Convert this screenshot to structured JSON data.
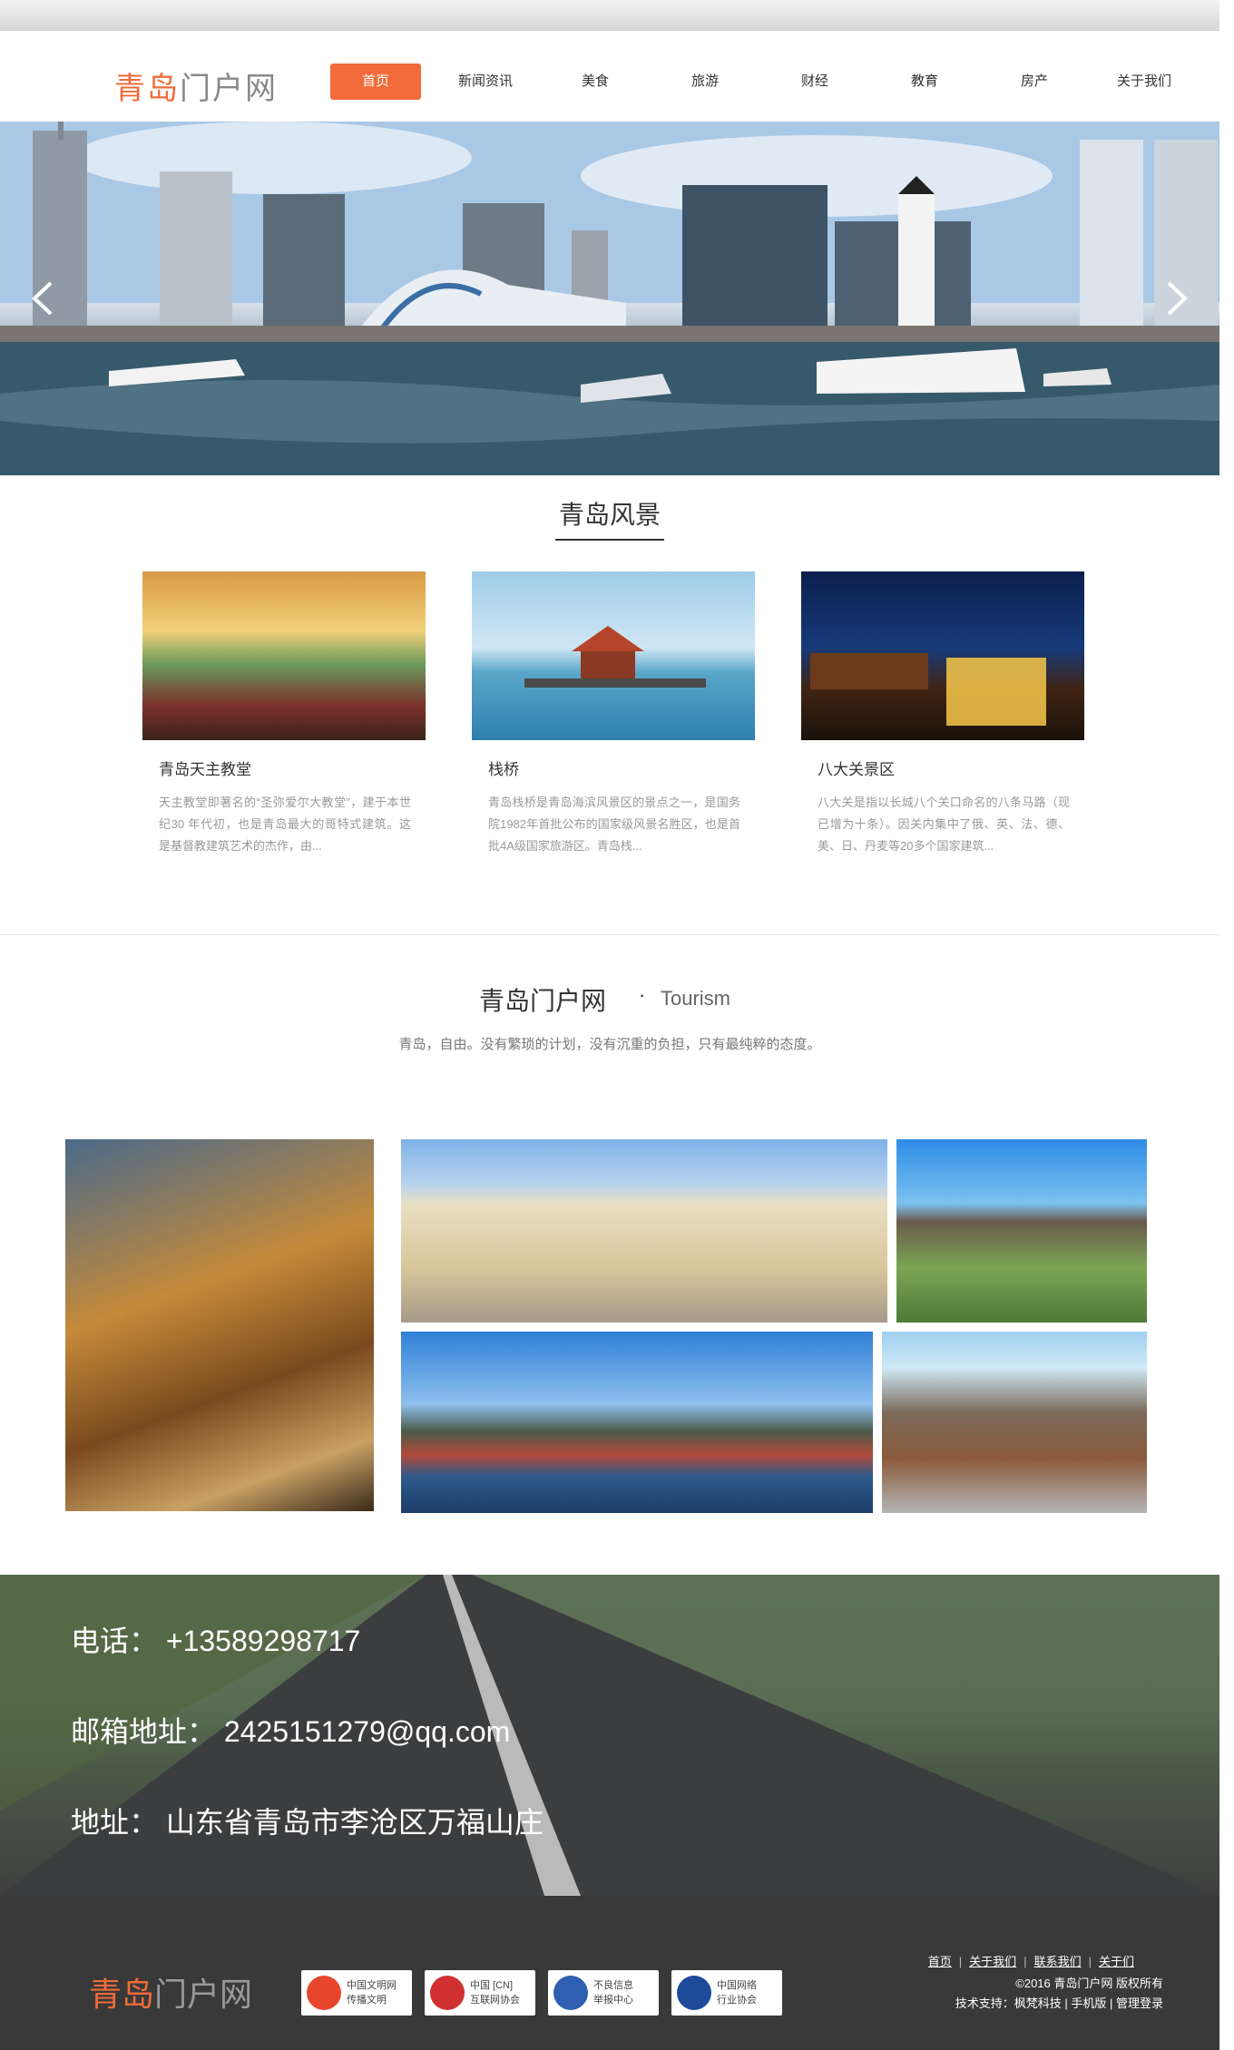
{
  "header": {
    "logo_part1": "青岛",
    "logo_part2": "门户网",
    "nav": [
      "首页",
      "新闻资讯",
      "美食",
      "旅游",
      "财经",
      "教育",
      "房产",
      "关于我们"
    ]
  },
  "banner": {
    "prev_icon": "chevron-left-icon",
    "next_icon": "chevron-right-icon"
  },
  "scenery": {
    "title": "青岛风景",
    "cards": [
      {
        "title": "青岛天主教堂",
        "desc": "天主教堂即著名的“圣弥爱尔大教堂”，建于本世纪30 年代初，也是青岛最大的哥特式建筑。这是基督教建筑艺术的杰作，由..."
      },
      {
        "title": "栈桥",
        "desc": "青岛栈桥是青岛海滨风景区的景点之一，是国务院1982年首批公布的国家级风景名胜区，也是首批4A级国家旅游区。青岛栈..."
      },
      {
        "title": "八大关景区",
        "desc": "八大关是指以长城八个关口命名的八条马路（现已增为十条）。因关内集中了俄、英、法、德、美、日、丹麦等20多个国家建筑..."
      }
    ]
  },
  "tourism": {
    "title": "青岛门户网",
    "dot": "·",
    "subtitle": "Tourism",
    "slogan": "青岛，自由。没有繁琐的计划，没有沉重的负担，只有最纯粹的态度。"
  },
  "contact": {
    "phone": "电话： +13589298717",
    "email": "邮箱地址： 2425151279@qq.com",
    "address": "地址：    山东省青岛市李沧区万福山庄"
  },
  "footer": {
    "logo_part1": "青岛",
    "logo_part2": "门户网",
    "badges": [
      {
        "line1": "中国文明网",
        "line2": "传播文明"
      },
      {
        "line1": "中国 [CN]",
        "line2": "互联网协会"
      },
      {
        "line1": "不良信息",
        "line2": "举报中心"
      },
      {
        "line1": "中国网络",
        "line2": "行业协会"
      }
    ],
    "links": [
      "首页",
      "关于我们",
      "联系我们",
      "关于们"
    ],
    "copyright": "©2016 青岛门户网 版权所有",
    "support": "技术支持：枫梵科技 | 手机版 | 管理登录"
  },
  "colors": {
    "accent": "#f26b3a",
    "footer_bg": "#393939"
  }
}
